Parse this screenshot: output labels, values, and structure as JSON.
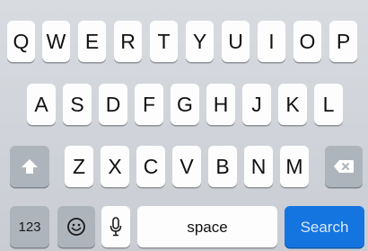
{
  "keyboard": {
    "row1": [
      "Q",
      "W",
      "E",
      "R",
      "T",
      "Y",
      "U",
      "I",
      "O",
      "P"
    ],
    "row2": [
      "A",
      "S",
      "D",
      "F",
      "G",
      "H",
      "J",
      "K",
      "L"
    ],
    "row3": [
      "Z",
      "X",
      "C",
      "V",
      "B",
      "N",
      "M"
    ],
    "numbers_label": "123",
    "space_label": "space",
    "search_label": "Search"
  },
  "icons": {
    "shift": "shift-arrow-icon",
    "delete": "delete-backspace-icon",
    "emoji": "emoji-smiley-icon",
    "mic": "microphone-icon"
  },
  "colors": {
    "letter_key": "#fdfdfd",
    "function_key": "#aeb4bc",
    "search_key": "#1474e0",
    "background": "#d1d5db"
  }
}
